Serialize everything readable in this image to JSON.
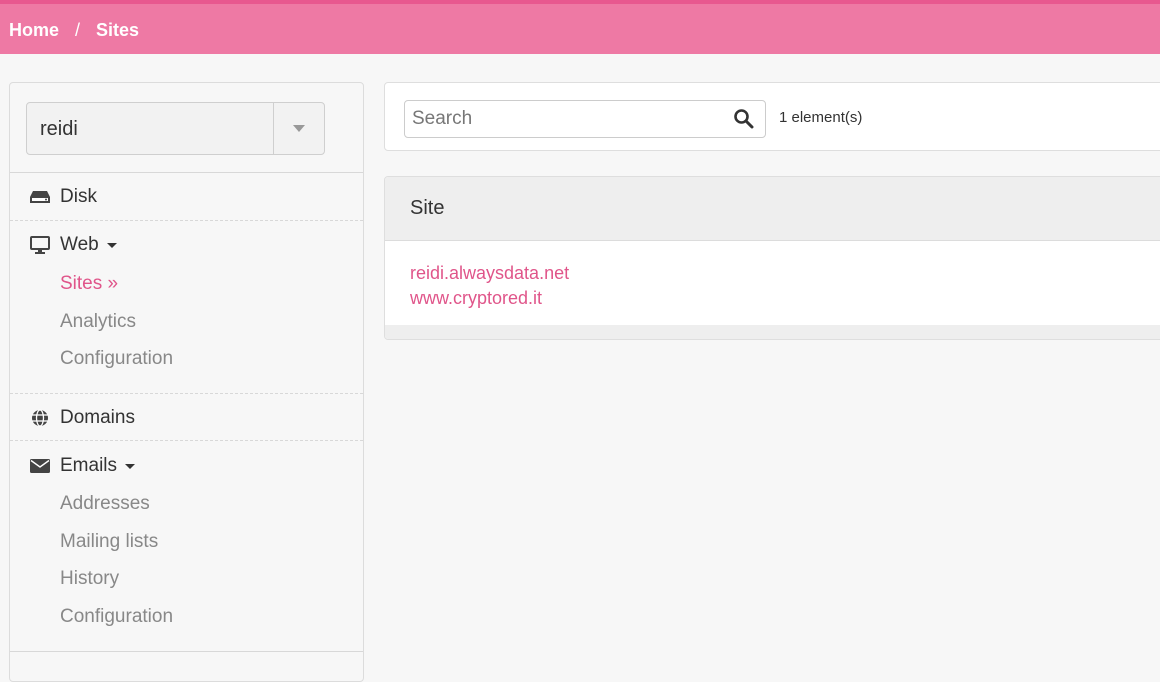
{
  "breadcrumb": {
    "home": "Home",
    "separator": "/",
    "current": "Sites"
  },
  "account": {
    "value": "reidi"
  },
  "sidebar": {
    "disk": "Disk",
    "web": {
      "label": "Web",
      "items": [
        "Sites »",
        "Analytics",
        "Configuration"
      ]
    },
    "domains": "Domains",
    "emails": {
      "label": "Emails",
      "items": [
        "Addresses",
        "Mailing lists",
        "History",
        "Configuration"
      ]
    }
  },
  "search": {
    "placeholder": "Search",
    "count": "1 element(s)"
  },
  "table": {
    "header": "Site",
    "rows": [
      {
        "sites": [
          "reidi.alwaysdata.net",
          "www.cryptored.it"
        ]
      }
    ]
  },
  "colors": {
    "accent": "#e0558a",
    "topbar": "#ee79a4",
    "topbar_border": "#e8588f"
  },
  "icons": {
    "disk": "hdd-icon",
    "web": "monitor-icon",
    "domains": "globe-icon",
    "emails": "envelope-icon",
    "search": "search-icon",
    "dropdown": "caret-down-icon"
  }
}
